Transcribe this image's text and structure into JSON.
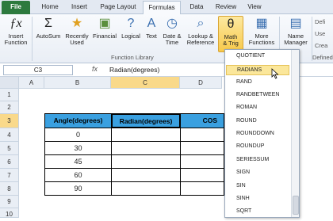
{
  "tabs": [
    "File",
    "Home",
    "Insert",
    "Page Layout",
    "Formulas",
    "Data",
    "Review",
    "View"
  ],
  "ribbon": {
    "insert_function": "Insert\nFunction",
    "autosum": "AutoSum",
    "recently_used": "Recently\nUsed",
    "financial": "Financial",
    "logical": "Logical",
    "text": "Text",
    "date_time": "Date &\nTime",
    "lookup": "Lookup &\nReference",
    "math": "Math\n& Trig",
    "more": "More\nFunctions",
    "name_manager": "Name\nManager",
    "group_label": "Function Library",
    "defined_label": "Defined",
    "right_items": [
      "Defi",
      "Use",
      "Crea"
    ]
  },
  "formula_bar": {
    "namebox": "C3",
    "fx": "fx",
    "formula": "Radian(degrees)"
  },
  "columns": [
    "A",
    "B",
    "C",
    "D"
  ],
  "rows": [
    "1",
    "2",
    "3",
    "4",
    "5",
    "6",
    "7",
    "8",
    "9",
    "10"
  ],
  "table": {
    "headers": [
      "Angle(degrees)",
      "Radian(degrees)",
      "COS"
    ],
    "angles": [
      "0",
      "30",
      "45",
      "60",
      "90"
    ]
  },
  "dropdown": {
    "items": [
      "QUOTIENT",
      "RADIANS",
      "RAND",
      "RANDBETWEEN",
      "ROMAN",
      "ROUND",
      "ROUNDDOWN",
      "ROUNDUP",
      "SERIESSUM",
      "SIGN",
      "SIN",
      "SINH",
      "SQRT"
    ],
    "highlighted": "RADIANS"
  },
  "colors": {
    "accent_tab": "#2d7a3e",
    "header_fill": "#3aa0e0",
    "highlight": "#fbe79b"
  }
}
